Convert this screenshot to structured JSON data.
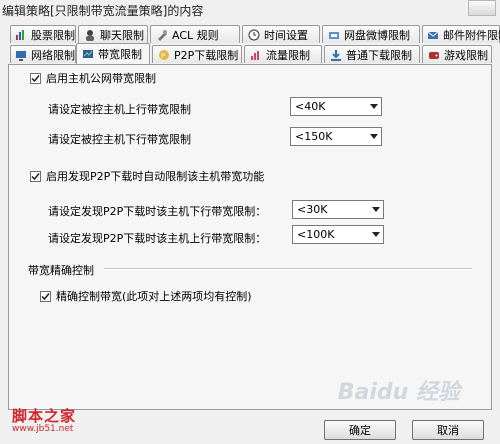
{
  "window": {
    "title": "编辑策略[只限制带宽流量策略]的内容"
  },
  "tabs_row1": [
    {
      "label": "股票限制",
      "icon": "stock-icon"
    },
    {
      "label": "聊天限制",
      "icon": "chat-icon"
    },
    {
      "label": "ACL 规则",
      "icon": "acl-icon"
    },
    {
      "label": "时间设置",
      "icon": "clock-icon"
    },
    {
      "label": "网盘微博限制",
      "icon": "cloud-drive-icon"
    },
    {
      "label": "邮件附件限制",
      "icon": "mail-icon"
    }
  ],
  "tabs_row2": [
    {
      "label": "网络限制",
      "icon": "network-icon"
    },
    {
      "label": "带宽限制",
      "icon": "bandwidth-icon",
      "active": true
    },
    {
      "label": "P2P下载限制",
      "icon": "p2p-icon"
    },
    {
      "label": "流量限制",
      "icon": "traffic-icon"
    },
    {
      "label": "普通下载限制",
      "icon": "download-icon"
    },
    {
      "label": "游戏限制",
      "icon": "game-icon"
    }
  ],
  "section_host": {
    "checkbox_label": "启用主机公网带宽限制",
    "checked": true,
    "upload_label": "请设定被控主机上行带宽限制",
    "upload_value": "<40K",
    "download_label": "请设定被控主机下行带宽限制",
    "download_value": "<150K"
  },
  "section_p2p": {
    "checkbox_label": "启用发现P2P下载时自动限制该主机带宽功能",
    "checked": true,
    "download_label": "请设定发现P2P下载时该主机下行带宽限制：",
    "download_value": "<30K",
    "upload_label": "请设定发现P2P下载时该主机上行带宽限制：",
    "upload_value": "<100K"
  },
  "section_precise": {
    "group_label": "带宽精确控制",
    "checkbox_label": "精确控制带宽(此项对上述两项均有控制)",
    "checked": true
  },
  "buttons": {
    "ok": "确定",
    "cancel": "取消"
  },
  "watermark": {
    "site_cn": "脚本之家",
    "site_url": "www.jb51.net",
    "baidu": "Baidu 经验"
  }
}
